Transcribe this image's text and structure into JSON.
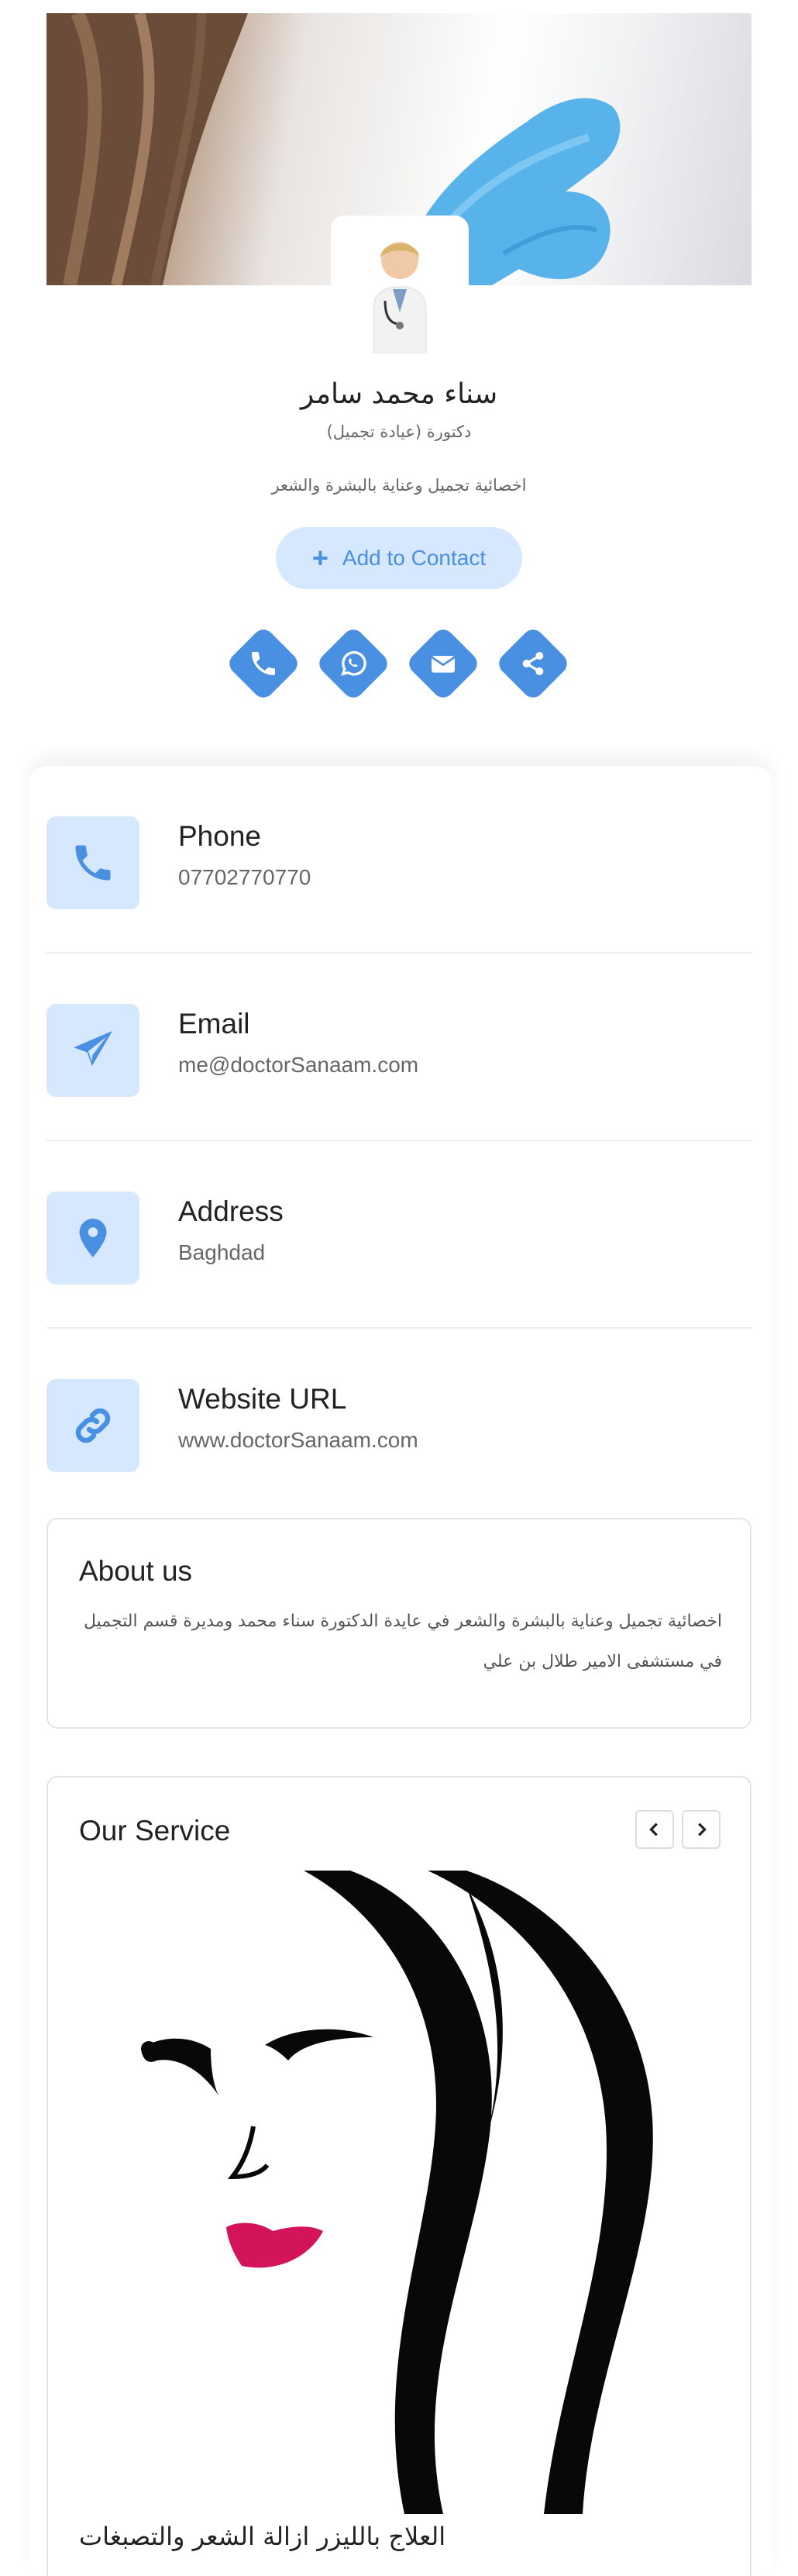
{
  "profile": {
    "name": "سناء محمد سامر",
    "title": "دكتورة (عيادة تجميل)",
    "description": "اخصائية تجميل وعناية بالبشرة والشعر"
  },
  "actions": {
    "add_contact_label": "Add to Contact",
    "social_icons": [
      "phone-icon",
      "whatsapp-icon",
      "envelope-icon",
      "share-icon"
    ]
  },
  "contacts": [
    {
      "icon": "phone-icon",
      "label": "Phone",
      "value": "07702770770"
    },
    {
      "icon": "paper-plane-icon",
      "label": "Email",
      "value": "me@doctorSanaam.com"
    },
    {
      "icon": "map-pin-icon",
      "label": "Address",
      "value": "Baghdad"
    },
    {
      "icon": "link-icon",
      "label": "Website URL",
      "value": "www.doctorSanaam.com"
    }
  ],
  "about": {
    "heading": "About us",
    "text": "اخصائية تجميل وعناية بالبشرة والشعر في عايدة الدكتورة سناء محمد ومديرة قسم التجميل في مستشفى الامير طلال بن علي"
  },
  "service": {
    "heading": "Our Service",
    "slide_caption": "العلاج بالليزر ازالة الشعر والتصبغات"
  },
  "colors": {
    "accent": "#4a90e2",
    "accent_light": "#d6e8fd",
    "text": "#222222",
    "muted": "#666666"
  }
}
